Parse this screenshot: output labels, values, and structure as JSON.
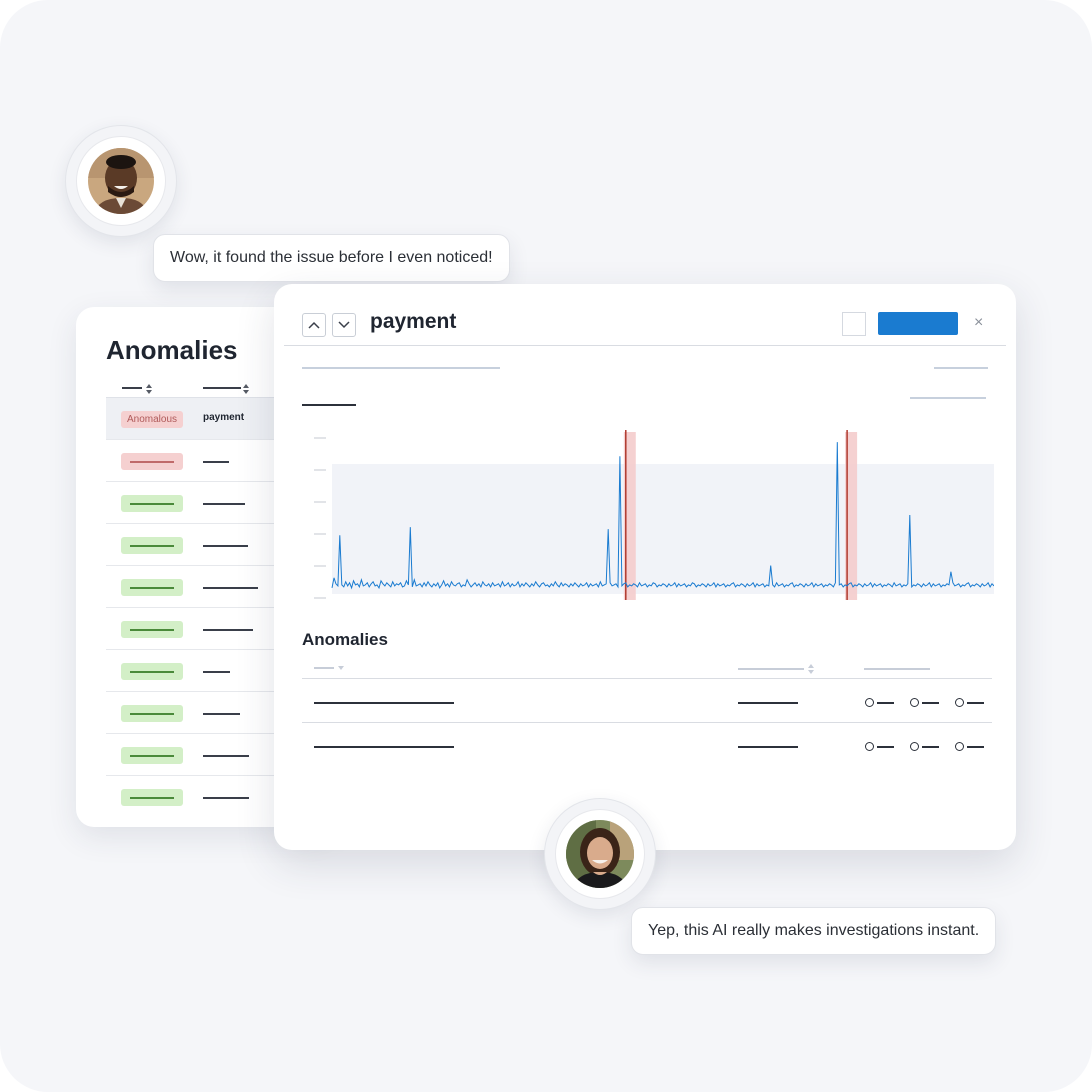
{
  "chat": {
    "message_1": "Wow, it found the issue before I even noticed!",
    "message_2": "Yep, this AI really makes investigations instant."
  },
  "left_panel": {
    "title": "Anomalies",
    "rows": [
      {
        "status": "Anomalous",
        "name": "payment"
      }
    ]
  },
  "main_panel": {
    "title": "payment",
    "section_title": "Anomalies"
  },
  "colors": {
    "accent_blue": "#1a7bd0",
    "anomaly_red": "#c0392b",
    "anomaly_badge": "#f5d0d0",
    "normal_badge": "#d3efc7"
  },
  "chart_data": {
    "type": "line",
    "series": [
      {
        "values": [
          8,
          18,
          12,
          10,
          16,
          11,
          9,
          14,
          10,
          13,
          8,
          15,
          11,
          12,
          9,
          16,
          10,
          11,
          13,
          9,
          12,
          14,
          10,
          11,
          8,
          15,
          12,
          10,
          13,
          11,
          9,
          14,
          10,
          12,
          11,
          13,
          9,
          10,
          15,
          11,
          12,
          9,
          16,
          10,
          11,
          12,
          9,
          13,
          10,
          14,
          11,
          9,
          12,
          10,
          13,
          8,
          11,
          15,
          10,
          12,
          9,
          14,
          11,
          10,
          12,
          13,
          9,
          11,
          10,
          16,
          12,
          9,
          11,
          13,
          10,
          12,
          9,
          14,
          11,
          10,
          12,
          9,
          13,
          10,
          11,
          12,
          9,
          14,
          10,
          11,
          13,
          9,
          12,
          10,
          11,
          14,
          9,
          12,
          10,
          13,
          11,
          9,
          12,
          10,
          14,
          11,
          9,
          12,
          13,
          10,
          11,
          9,
          12,
          10,
          14,
          11,
          9,
          13,
          10,
          12,
          11,
          9,
          12,
          10,
          13,
          11,
          9,
          12,
          10,
          11,
          13,
          9,
          12,
          10,
          11,
          12,
          9,
          14,
          10,
          11,
          12,
          9,
          13,
          10,
          11,
          12,
          9,
          11,
          10,
          12,
          13,
          9,
          11,
          10,
          12,
          11,
          9,
          13,
          10,
          11,
          12,
          9,
          11,
          10,
          13,
          12,
          9,
          11,
          10,
          12,
          11,
          9,
          12,
          10,
          11,
          13,
          9,
          12,
          10,
          11,
          12,
          9,
          11,
          10,
          13,
          12,
          9,
          11,
          10,
          12,
          11,
          9,
          12,
          10,
          11,
          13,
          9,
          12,
          10,
          11,
          12,
          9,
          11,
          10,
          12,
          13,
          9,
          11,
          10,
          12,
          11,
          9,
          12,
          10,
          11,
          13,
          9,
          12,
          10,
          11,
          12,
          9,
          11,
          10,
          12,
          11,
          9,
          13,
          10,
          11,
          12,
          9,
          11,
          10,
          12,
          13,
          9,
          11,
          10,
          12,
          11,
          9,
          12,
          10,
          11,
          13,
          9,
          12,
          10,
          11,
          12,
          9,
          11,
          10,
          12,
          11,
          9,
          13,
          10,
          11,
          12,
          9,
          11,
          10,
          12,
          13,
          9,
          11,
          10,
          12,
          11,
          9,
          12,
          10,
          11,
          13,
          9,
          12,
          10,
          11,
          12,
          9,
          11,
          10,
          12,
          11,
          9,
          13,
          10,
          11,
          12,
          9,
          11,
          10,
          12,
          13,
          9,
          11,
          10,
          12,
          11,
          9,
          12,
          10,
          11,
          13,
          9,
          12,
          10,
          11,
          12,
          9,
          11,
          10,
          12,
          11,
          9,
          13,
          10,
          11,
          12,
          9,
          11,
          10,
          12,
          13,
          9,
          11,
          10,
          12,
          11,
          9,
          12,
          10,
          11,
          13,
          9,
          12,
          10
        ],
        "spikes": [
          [
            4,
            60
          ],
          [
            40,
            68
          ],
          [
            141,
            66
          ],
          [
            147,
            138
          ],
          [
            224,
            30
          ],
          [
            258,
            152
          ],
          [
            295,
            80
          ],
          [
            316,
            24
          ],
          [
            340,
            21
          ]
        ]
      }
    ],
    "anomaly_markers": [
      150,
      263
    ],
    "grid": false
  }
}
